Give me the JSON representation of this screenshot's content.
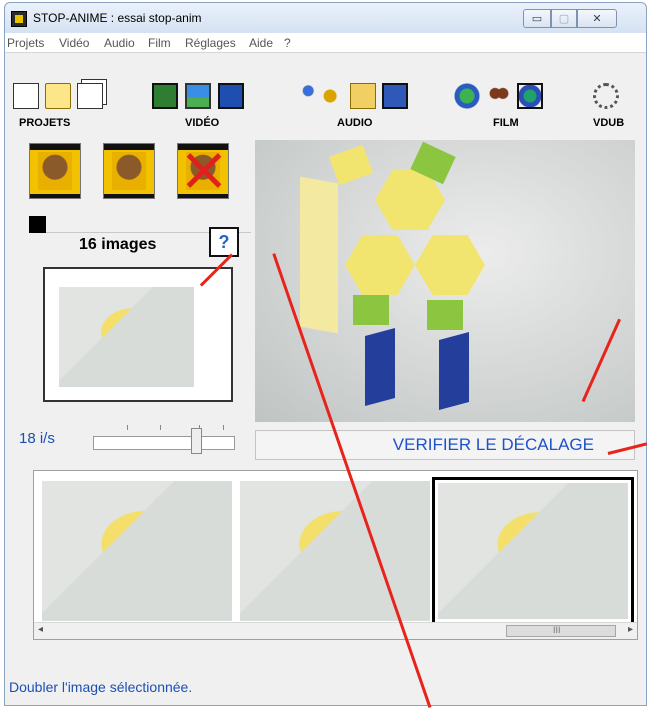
{
  "window": {
    "title": "STOP-ANIME : essai stop-anim",
    "controls": {
      "minimize": "▭",
      "maximize": "▢",
      "close": "✕"
    }
  },
  "menu": [
    "Projets",
    "Vidéo",
    "Audio",
    "Film",
    "Réglages",
    "Aide",
    "?"
  ],
  "toolbar": {
    "groups": [
      "PROJETS",
      "VIDÉO",
      "AUDIO",
      "FILM",
      "VDUB"
    ],
    "icons": [
      "new-doc-icon",
      "open-folder-icon",
      "copy-pages-icon",
      "film-strip-icon",
      "screen-icon",
      "screen-film-icon",
      "microphone-icon",
      "speaker-icon",
      "folder-sound-icon",
      "sound-panel-icon",
      "globe-film-icon",
      "reels-icon",
      "reel-icon",
      "gear-icon"
    ]
  },
  "image_panel": {
    "count_label": "16 images",
    "help_label": "?"
  },
  "speed": {
    "label": "18 i/s",
    "value": 18
  },
  "verify_button": "VERIFIER LE DÉCALAGE",
  "status_bar": "Doubler l'image sélectionnée.",
  "scrollbar": {
    "left_arrow": "◂",
    "right_arrow": "▸",
    "grip": "III"
  },
  "accent_color": "#1c4fb5",
  "arrow_color": "#e8231b"
}
